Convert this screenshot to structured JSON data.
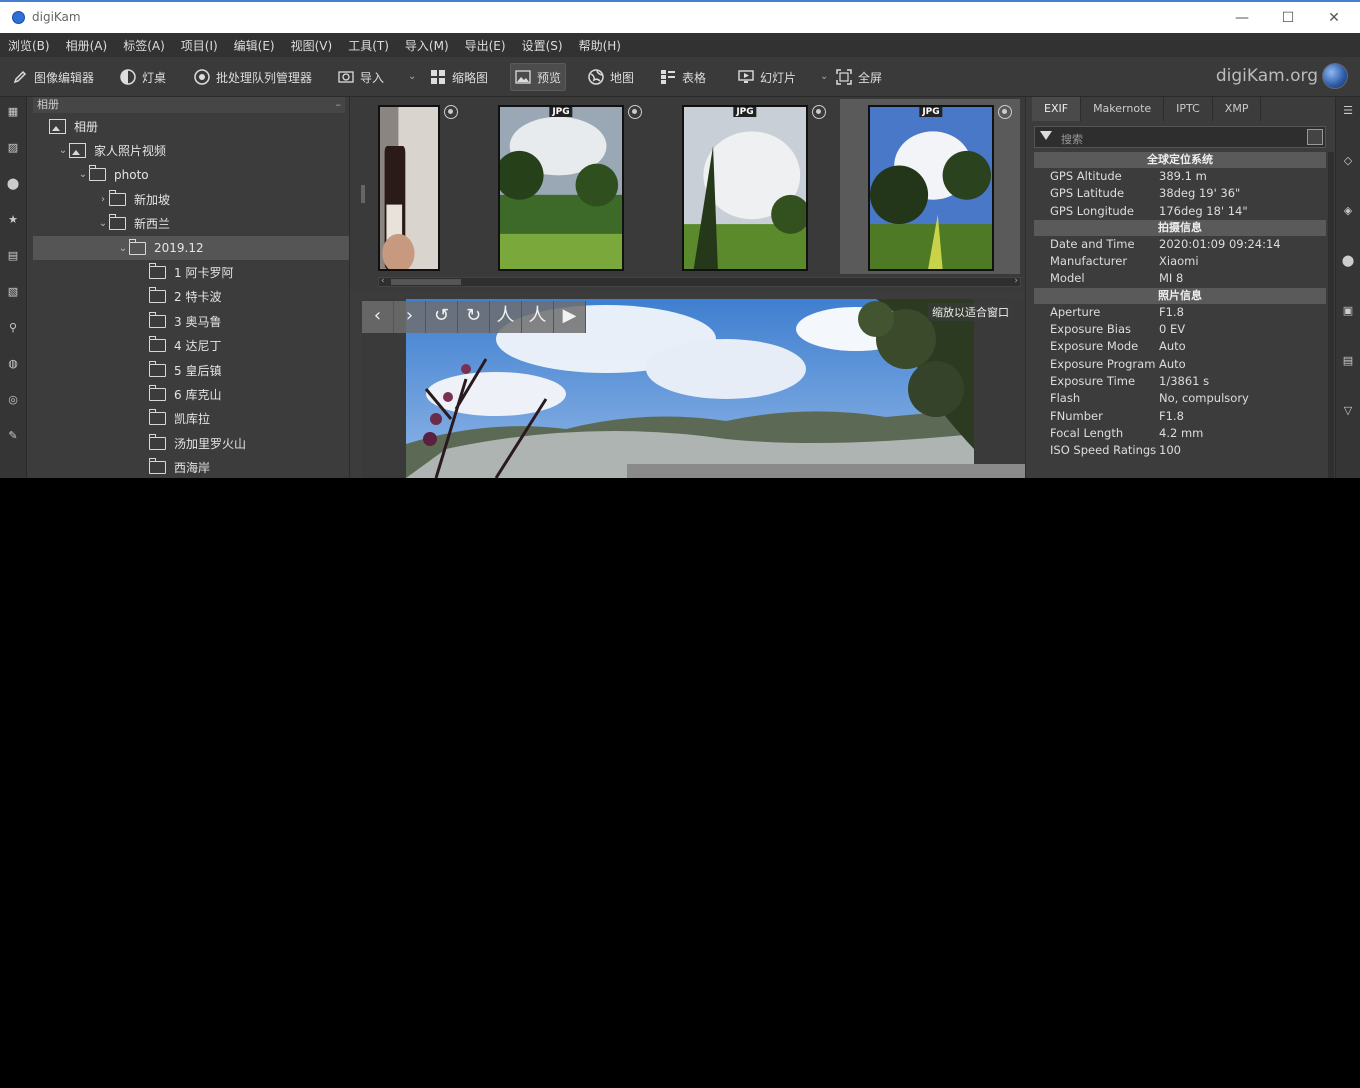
{
  "window": {
    "title": "digiKam",
    "minimize": "—",
    "maximize": "☐",
    "close": "✕"
  },
  "menu": [
    "浏览(B)",
    "相册(A)",
    "标签(A)",
    "项目(I)",
    "编辑(E)",
    "视图(V)",
    "工具(T)",
    "导入(M)",
    "导出(E)",
    "设置(S)",
    "帮助(H)"
  ],
  "toolbar": {
    "image_editor": "图像编辑器",
    "light_table": "灯桌",
    "batch_queue": "批处理队列管理器",
    "import": "导入",
    "thumbnails": "缩略图",
    "preview": "预览",
    "map": "地图",
    "table": "表格",
    "slideshow": "幻灯片",
    "fullscreen": "全屏",
    "brand": "digiKam.org"
  },
  "tree": {
    "header": "相册",
    "items": [
      {
        "label": "相册",
        "type": "picture",
        "indent": 0,
        "arrow": ""
      },
      {
        "label": "家人照片视频",
        "type": "picture",
        "indent": 1,
        "arrow": "⌄"
      },
      {
        "label": "photo",
        "type": "folder",
        "indent": 2,
        "arrow": "⌄"
      },
      {
        "label": "新加坡",
        "type": "folder",
        "indent": 3,
        "arrow": "›"
      },
      {
        "label": "新西兰",
        "type": "folder",
        "indent": 3,
        "arrow": "⌄"
      },
      {
        "label": "2019.12",
        "type": "folder",
        "indent": 4,
        "arrow": "⌄",
        "selected": true
      },
      {
        "label": "1 阿卡罗阿",
        "type": "folder",
        "indent": 5,
        "arrow": ""
      },
      {
        "label": "2 特卡波",
        "type": "folder",
        "indent": 5,
        "arrow": ""
      },
      {
        "label": "3 奥马鲁",
        "type": "folder",
        "indent": 5,
        "arrow": ""
      },
      {
        "label": "4 达尼丁",
        "type": "folder",
        "indent": 5,
        "arrow": ""
      },
      {
        "label": "5 皇后镇",
        "type": "folder",
        "indent": 5,
        "arrow": ""
      },
      {
        "label": "6 库克山",
        "type": "folder",
        "indent": 5,
        "arrow": ""
      },
      {
        "label": "凯库拉",
        "type": "folder",
        "indent": 5,
        "arrow": ""
      },
      {
        "label": "汤加里罗火山",
        "type": "folder",
        "indent": 5,
        "arrow": ""
      },
      {
        "label": "西海岸",
        "type": "folder",
        "indent": 5,
        "arrow": ""
      }
    ]
  },
  "left_tabs": [
    "相册",
    "标签",
    "星",
    "日期",
    "时间",
    "搜索",
    "相似",
    "地图",
    "人脸",
    "编辑"
  ],
  "right_tabs": [
    "属性",
    "元数据",
    "颜色",
    "地理",
    "标题",
    "版本",
    "过滤"
  ],
  "thumbnails": [
    {
      "badge": "",
      "selected": false
    },
    {
      "badge": "JPG",
      "selected": false
    },
    {
      "badge": "JPG",
      "selected": false
    },
    {
      "badge": "JPG",
      "selected": true
    }
  ],
  "preview": {
    "fit_label": "缩放以适合窗口",
    "tools": [
      "‹",
      "›",
      "↺",
      "↻",
      "人",
      "人",
      "▶"
    ]
  },
  "metadata": {
    "tabs": [
      "EXIF",
      "Makernote",
      "IPTC",
      "XMP"
    ],
    "search_placeholder": "搜索",
    "groups": [
      {
        "title": "全球定位系统",
        "rows": [
          {
            "k": "GPS Altitude",
            "v": "389.1 m"
          },
          {
            "k": "GPS Latitude",
            "v": "38deg 19' 36\""
          },
          {
            "k": "GPS Longitude",
            "v": "176deg 18' 14\""
          }
        ]
      },
      {
        "title": "拍摄信息",
        "rows": [
          {
            "k": "Date and Time",
            "v": "2020:01:09 09:24:14"
          },
          {
            "k": "Manufacturer",
            "v": "Xiaomi"
          },
          {
            "k": "Model",
            "v": "MI 8"
          }
        ]
      },
      {
        "title": "照片信息",
        "rows": [
          {
            "k": "Aperture",
            "v": "F1.8"
          },
          {
            "k": "Exposure Bias",
            "v": "0 EV"
          },
          {
            "k": "Exposure Mode",
            "v": "Auto"
          },
          {
            "k": "Exposure Program",
            "v": "Auto"
          },
          {
            "k": "Exposure Time",
            "v": "1/3861 s"
          },
          {
            "k": "Flash",
            "v": "No, compulsory"
          },
          {
            "k": "FNumber",
            "v": "F1.8"
          },
          {
            "k": "Focal Length",
            "v": "4.2 mm"
          },
          {
            "k": "ISO Speed Ratings",
            "v": "100"
          }
        ]
      }
    ]
  }
}
